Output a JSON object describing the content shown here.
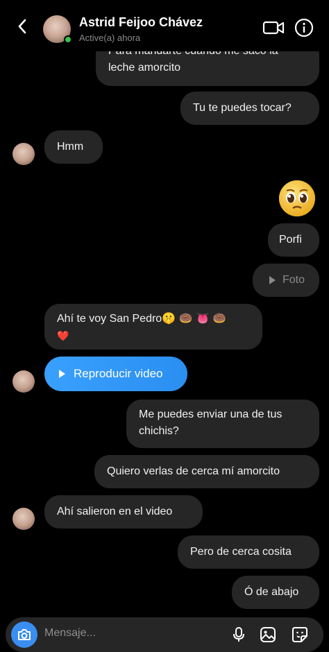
{
  "header": {
    "name": "Astrid Feijoo Chávez",
    "status": "Active(a) ahora"
  },
  "messages": [
    {
      "side": "right",
      "text_line1": "Para mandarte cuando me saco la",
      "text_line2": "leche amorcito"
    },
    {
      "side": "right",
      "text": "Tu te puedes tocar?"
    },
    {
      "side": "left",
      "text": "Hmm"
    },
    {
      "side": "right",
      "emoji": "🥺"
    },
    {
      "side": "right",
      "text": "Porfi"
    },
    {
      "side": "right",
      "type": "photo",
      "text": "Foto"
    },
    {
      "side": "left",
      "text_line1": "Ahí te voy San Pedro🤫 🍩 👅 🍩",
      "text_line2": "❤️"
    },
    {
      "side": "left",
      "type": "video",
      "text": "Reproducir video"
    },
    {
      "side": "right",
      "text_line1": "Me puedes enviar una de tus",
      "text_line2": "chichis?"
    },
    {
      "side": "right",
      "text": "Quiero verlas de cerca mí amorcito"
    },
    {
      "side": "left",
      "text": "Ahí salieron en el video"
    },
    {
      "side": "right",
      "text": "Pero de cerca cosita"
    },
    {
      "side": "right",
      "text": "Ó de abajo"
    }
  ],
  "composer": {
    "placeholder": "Mensaje..."
  },
  "colors": {
    "background": "#000000",
    "bubble": "#262626",
    "accent": "#3797f0",
    "online": "#37c24a"
  },
  "icons": [
    "back-icon",
    "video-call-icon",
    "info-icon",
    "camera-icon",
    "microphone-icon",
    "gallery-icon",
    "sticker-icon",
    "play-icon"
  ]
}
